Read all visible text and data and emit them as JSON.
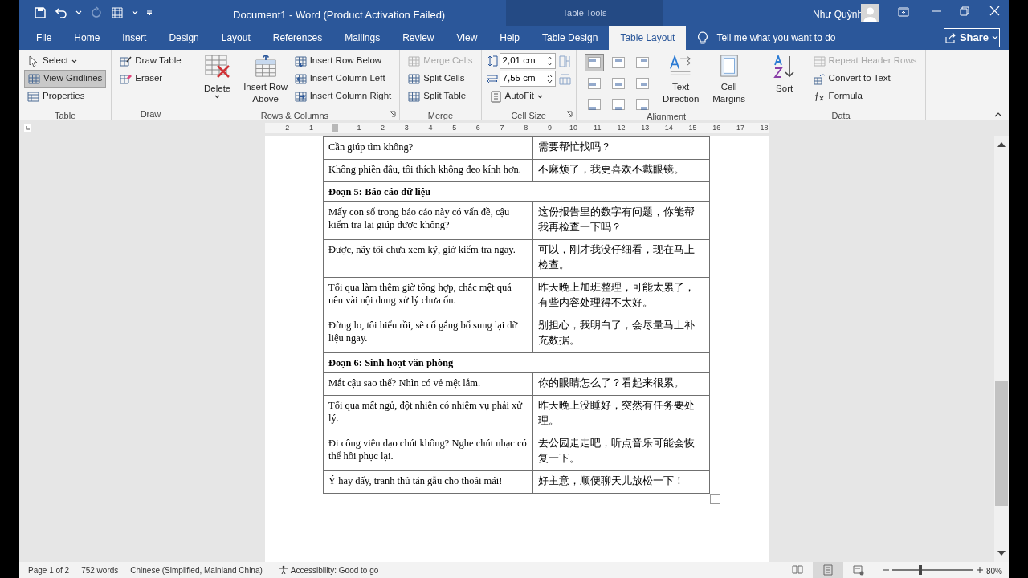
{
  "window": {
    "title": "Document1  -  Word (Product Activation Failed)",
    "context_label": "Table Tools",
    "user_name": "Như Quỳnh"
  },
  "tabs": [
    {
      "label": "File",
      "selected": false
    },
    {
      "label": "Home",
      "selected": false
    },
    {
      "label": "Insert",
      "selected": false
    },
    {
      "label": "Design",
      "selected": false
    },
    {
      "label": "Layout",
      "selected": false
    },
    {
      "label": "References",
      "selected": false
    },
    {
      "label": "Mailings",
      "selected": false
    },
    {
      "label": "Review",
      "selected": false
    },
    {
      "label": "View",
      "selected": false
    },
    {
      "label": "Help",
      "selected": false
    },
    {
      "label": "Table Design",
      "selected": false
    },
    {
      "label": "Table Layout",
      "selected": true
    }
  ],
  "tell_me": {
    "placeholder": "Tell me what you want to do"
  },
  "share": {
    "label": "Share"
  },
  "ribbon": [
    {
      "label": "Table",
      "launcher": false,
      "columns": [
        [
          {
            "kind": "small",
            "label": "Select",
            "dropdown": true,
            "on": false
          },
          {
            "kind": "small",
            "label": "View Gridlines",
            "dropdown": false,
            "on": true
          },
          {
            "kind": "small",
            "label": "Properties",
            "dropdown": false,
            "on": false
          }
        ]
      ]
    },
    {
      "label": "Draw",
      "launcher": false,
      "columns": [
        [
          {
            "kind": "small",
            "label": "Draw Table"
          },
          {
            "kind": "small",
            "label": "Eraser"
          }
        ]
      ]
    },
    {
      "label": "Rows & Columns",
      "launcher": true,
      "columns": [
        [
          {
            "kind": "large",
            "label": "Delete",
            "dropdown": true
          }
        ],
        [
          {
            "kind": "large",
            "label": "Insert Row Above",
            "dropdown": false
          }
        ],
        [
          {
            "kind": "small",
            "label": "Insert Row Below"
          },
          {
            "kind": "small",
            "label": "Insert Column Left"
          },
          {
            "kind": "small",
            "label": "Insert Column Right"
          }
        ]
      ]
    },
    {
      "label": "Merge",
      "launcher": false,
      "columns": [
        [
          {
            "kind": "small",
            "label": "Merge Cells",
            "disabled": true
          },
          {
            "kind": "small",
            "label": "Split Cells",
            "disabled": false
          },
          {
            "kind": "small",
            "label": "Split Table",
            "disabled": false
          }
        ]
      ]
    },
    {
      "label": "Cell Size",
      "launcher": true,
      "columns": [
        [
          {
            "kind": "field",
            "value": "2,01 cm"
          },
          {
            "kind": "field",
            "value": "7,55 cm"
          },
          {
            "kind": "small",
            "label": "AutoFit",
            "dropdown": true
          }
        ],
        [
          {
            "kind": "icon_button"
          },
          {
            "kind": "icon_button"
          }
        ]
      ]
    },
    {
      "label": "Alignment",
      "launcher": false,
      "columns": [
        [
          {
            "kind": "align_grid",
            "cells": [
              {
                "selected": true
              },
              {
                "selected": false
              },
              {
                "selected": false
              },
              {
                "selected": false
              },
              {
                "selected": false
              },
              {
                "selected": false
              },
              {
                "selected": false
              },
              {
                "selected": false
              },
              {
                "selected": false
              }
            ]
          }
        ],
        [
          {
            "kind": "large",
            "label": "Text Direction",
            "dropdown": false
          }
        ],
        [
          {
            "kind": "large",
            "label": "Cell Margins",
            "dropdown": false
          }
        ]
      ]
    },
    {
      "label": "Data",
      "launcher": false,
      "columns": [
        [
          {
            "kind": "large",
            "label": "Sort",
            "dropdown": false
          }
        ],
        [
          {
            "kind": "small",
            "label": "Repeat Header Rows",
            "disabled": true
          },
          {
            "kind": "small",
            "label": "Convert to Text",
            "disabled": false
          },
          {
            "kind": "small",
            "label": "Formula",
            "disabled": false
          }
        ]
      ]
    }
  ],
  "ruler": {
    "labels": [
      "2",
      "1",
      "1",
      "2",
      "3",
      "4",
      "5",
      "6",
      "7",
      "8",
      "9",
      "10",
      "11",
      "12",
      "13",
      "14",
      "15",
      "16",
      "17",
      "18"
    ]
  },
  "document": {
    "rows": [
      {
        "kind": "pair",
        "vi": "Cần giúp tìm không?",
        "zh": "需要帮忙找吗？"
      },
      {
        "kind": "pair",
        "vi": "Không phiền đâu, tôi thích không đeo kính hơn.",
        "zh": "不麻烦了，我更喜欢不戴眼镜。"
      },
      {
        "kind": "section",
        "text": "Đoạn 5: Báo cáo dữ liệu"
      },
      {
        "kind": "pair",
        "vi": "Mấy con số trong báo cáo này có vấn đề, cậu kiểm tra lại giúp được không?",
        "zh": "这份报告里的数字有问题，你能帮我再检查一下吗？"
      },
      {
        "kind": "pair",
        "vi": "Được, nãy tôi chưa xem kỹ, giờ kiểm tra ngay.",
        "zh": "可以，刚才我没仔细看，现在马上检查。"
      },
      {
        "kind": "pair",
        "vi": "Tối qua làm thêm giờ tổng hợp, chắc mệt quá nên vài nội dung xử lý chưa ổn.",
        "zh": "昨天晚上加班整理，可能太累了，有些内容处理得不太好。"
      },
      {
        "kind": "pair",
        "vi": "Đừng lo, tôi hiểu rồi, sẽ cố gắng bổ sung lại dữ liệu ngay.",
        "zh": "别担心，我明白了，会尽量马上补充数据。"
      },
      {
        "kind": "section",
        "text": "Đoạn 6: Sinh hoạt văn phòng"
      },
      {
        "kind": "pair",
        "vi": "Mắt cậu sao thế? Nhìn có vẻ mệt lắm.",
        "zh": "你的眼睛怎么了？看起来很累。"
      },
      {
        "kind": "pair",
        "vi": "Tối qua mất ngủ, đột nhiên có nhiệm vụ phải xử lý.",
        "zh": "昨天晚上没睡好，突然有任务要处理。"
      },
      {
        "kind": "pair",
        "vi": "Đi công viên dạo chút không? Nghe chút nhạc có thể hồi phục lại.",
        "zh": "去公园走走吧，听点音乐可能会恢复一下。"
      },
      {
        "kind": "pair",
        "vi": "Ý hay đấy, tranh thủ tán gẫu cho thoải mái!",
        "zh": "好主意，顺便聊天儿放松一下！"
      }
    ]
  },
  "status_bar": {
    "page": "Page 1 of 2",
    "words": "752 words",
    "language": "Chinese (Simplified, Mainland China)",
    "accessibility": "Accessibility: Good to go",
    "views": [
      {
        "selected": false
      },
      {
        "selected": true
      },
      {
        "selected": false
      }
    ],
    "zoom": {
      "level": 0.35,
      "reading": "80%"
    }
  }
}
